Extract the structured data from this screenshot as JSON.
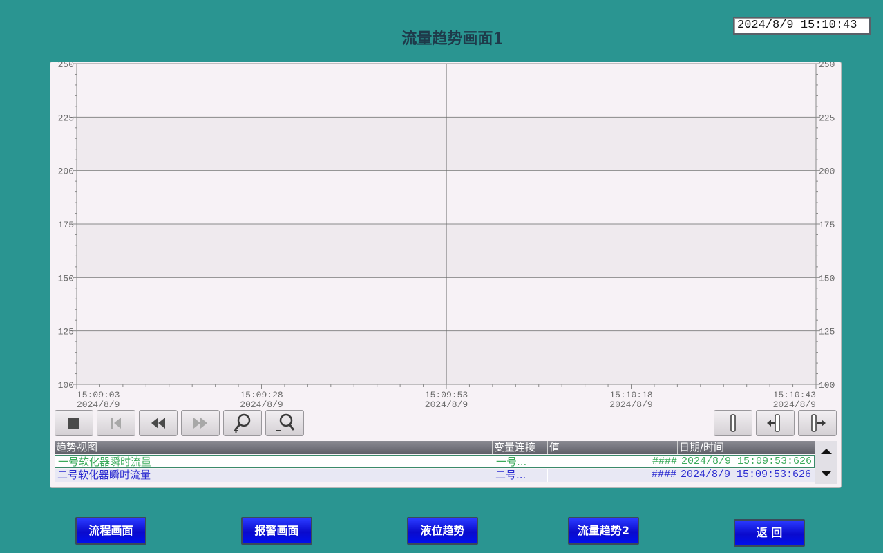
{
  "header": {
    "title": "流量趋势画面1",
    "clock": "2024/8/9 15:10:43"
  },
  "chart_data": {
    "type": "line",
    "title": "",
    "y_ticks": [
      "250",
      "225",
      "200",
      "175",
      "150",
      "125",
      "100"
    ],
    "ylim": [
      100,
      250
    ],
    "x_ticks": [
      {
        "time": "15:09:03",
        "date": "2024/8/9"
      },
      {
        "time": "15:09:28",
        "date": "2024/8/9"
      },
      {
        "time": "15:09:53",
        "date": "2024/8/9"
      },
      {
        "time": "15:10:18",
        "date": "2024/8/9"
      },
      {
        "time": "15:10:43",
        "date": "2024/8/9"
      }
    ],
    "grid": true,
    "series": [
      {
        "name": "一号软化器瞬时流量",
        "values": []
      },
      {
        "name": "二号软化器瞬时流量",
        "values": []
      }
    ]
  },
  "toolbar": {
    "left_buttons": [
      "stop-icon",
      "first-icon",
      "rewind-icon",
      "forward-icon",
      "zoom-in-icon",
      "zoom-out-icon"
    ],
    "right_buttons": [
      "ruler-icon",
      "ruler-left-icon",
      "ruler-right-icon"
    ]
  },
  "table": {
    "headers": {
      "name": "趋势视图",
      "link": "变量连接",
      "value": "值",
      "datetime": "日期/时间"
    },
    "rows": [
      {
        "name": "一号软化器瞬时流量",
        "link": "一号...",
        "value": "####",
        "datetime": "2024/8/9 15:09:53:626",
        "color": "#3aaa5a"
      },
      {
        "name": "二号软化器瞬时流量",
        "link": "二号...",
        "value": "####",
        "datetime": "2024/8/9 15:09:53:626",
        "color": "#2a2ad0"
      }
    ]
  },
  "nav": {
    "process": "流程画面",
    "alarm": "报警画面",
    "level_trend": "液位趋势",
    "flow_trend2": "流量趋势2",
    "back": "返  回"
  },
  "colors": {
    "background": "#2a9591",
    "nav_button": "#0a0acc",
    "series1": "#3aaa5a",
    "series2": "#2a2ad0"
  }
}
